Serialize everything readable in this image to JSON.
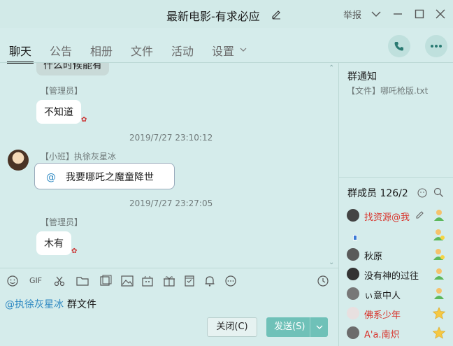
{
  "window": {
    "title": "最新电影-有求必应",
    "report_label": "举报"
  },
  "tabs": [
    {
      "label": "聊天",
      "active": true
    },
    {
      "label": "公告"
    },
    {
      "label": "相册"
    },
    {
      "label": "文件"
    },
    {
      "label": "活动"
    },
    {
      "label": "设置"
    }
  ],
  "messages": {
    "partial_top": "什么时候能有",
    "msg1": {
      "sender": "【管理员】",
      "text": "不知道"
    },
    "ts1": "2019/7/27 23:10:12",
    "msg2": {
      "sender": "【小班】执徐灰星冰",
      "at": "@",
      "text": "我要哪吒之魔童降世"
    },
    "ts2": "2019/7/27 23:27:05",
    "msg3": {
      "sender": "【管理员】",
      "text": "木有"
    }
  },
  "toolbar_icons": [
    "emoji-icon",
    "gif-icon",
    "scissors-icon",
    "folder-icon",
    "gallery-icon",
    "image-icon",
    "bag-icon",
    "gift-icon",
    "task-icon",
    "bell-icon",
    "more-icon",
    "history-icon"
  ],
  "toolbar": {
    "gif_label": "GIF"
  },
  "input": {
    "mention": "@执徐灰星冰",
    "text": "群文件"
  },
  "buttons": {
    "close_label": "关闭(C)",
    "send_label": "发送(S)"
  },
  "notice": {
    "title": "群通知",
    "item": "【文件】哪吒枪版.txt"
  },
  "members": {
    "title": "群成员 126/2",
    "list": [
      {
        "name": "找资源@我",
        "red": true
      },
      {
        "name": "",
        "red": false
      },
      {
        "name": "秋原",
        "red": false
      },
      {
        "name": "没有神的过往",
        "red": false
      },
      {
        "name": "ぃ意中人",
        "red": false
      },
      {
        "name": "佛系少年",
        "red": true
      },
      {
        "name": "A'a.南炽",
        "red": true
      }
    ]
  },
  "colors": {
    "background": "#d5eceb",
    "accent": "#6fc1b8",
    "mention": "#2e89c2",
    "owner_red": "#d8342c"
  }
}
